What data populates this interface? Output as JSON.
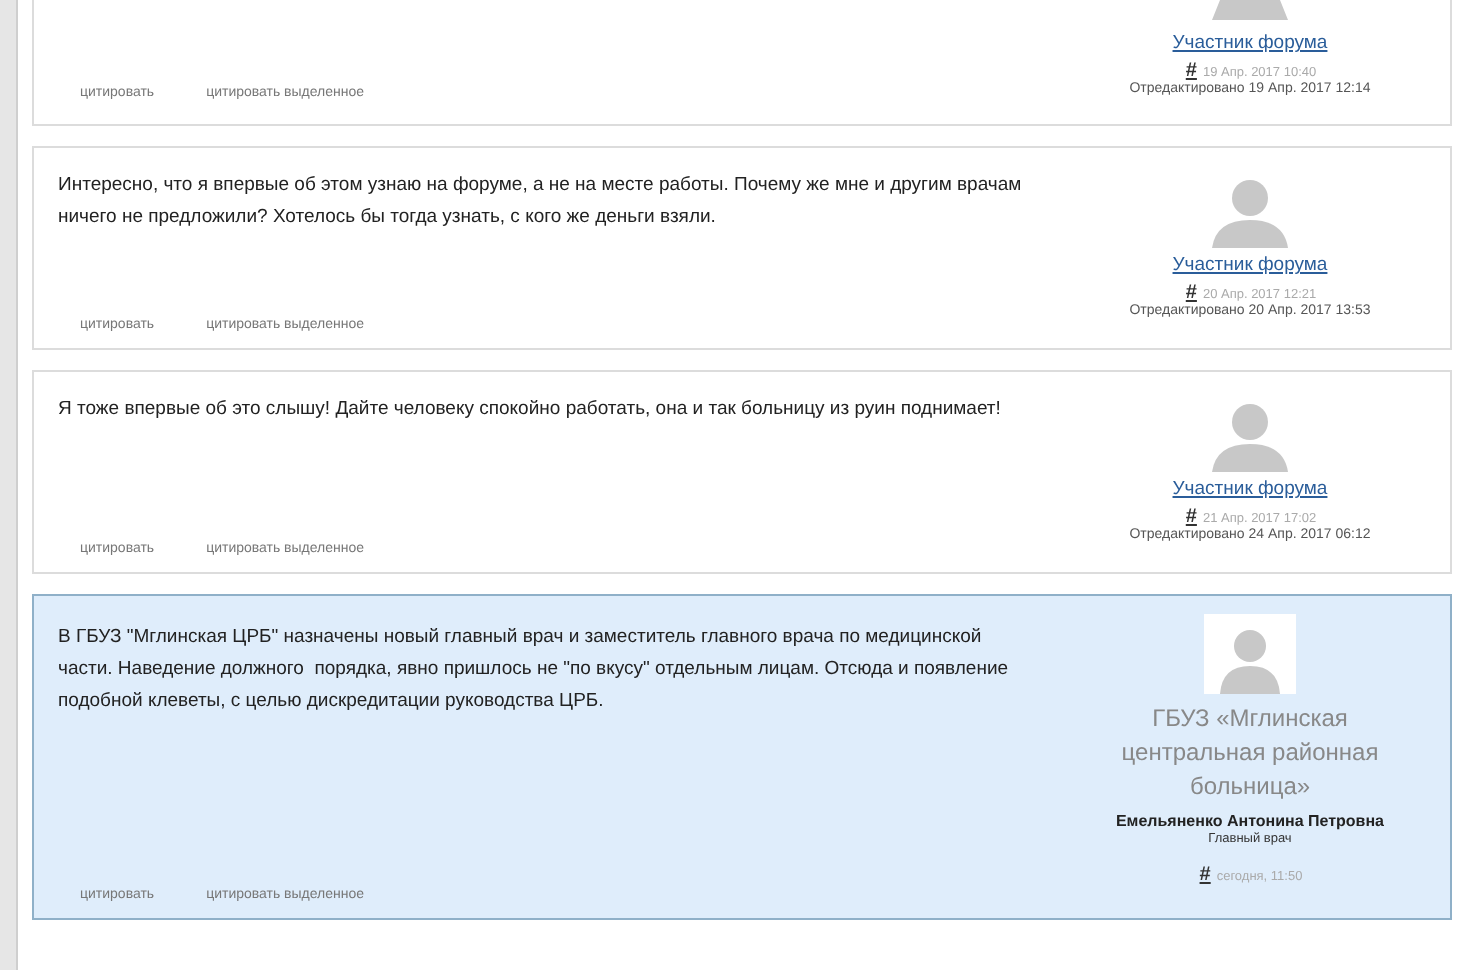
{
  "posts": [
    {
      "kind": "partial",
      "author": "Участник форума",
      "permalink": "#",
      "date": "19 Апр. 2017 10:40",
      "edited": "Отредактировано 19 Апр. 2017 12:14",
      "actions": [
        "цитировать",
        "цитировать выделенное"
      ]
    },
    {
      "kind": "member",
      "text": "Интересно, что я впервые об этом узнаю на форуме, а не на месте работы. Почему же мне и другим врачам ничего не предложили? Хотелось бы тогда узнать, с кого же деньги взяли.",
      "author": "Участник форума",
      "permalink": "#",
      "date": "20 Апр. 2017 12:21",
      "edited": "Отредактировано 20 Апр. 2017 13:53",
      "actions": [
        "цитировать",
        "цитировать выделенное"
      ]
    },
    {
      "kind": "member",
      "text": "Я тоже впервые об это слышу! Дайте человеку спокойно работать, она и так больницу из руин поднимает!",
      "author": "Участник форума",
      "permalink": "#",
      "date": "21 Апр. 2017 17:02",
      "edited": "Отредактировано 24 Апр. 2017 06:12",
      "actions": [
        "цитировать",
        "цитировать выделенное"
      ]
    },
    {
      "kind": "official",
      "text": "В ГБУЗ \"Мглинская ЦРБ\" назначены новый главный врач и заместитель главного врача по медицинской части. Наведение должного  порядка, явно пришлось не \"по вкусу\" отдельным лицам. Отсюда и появление подобной клеветы, с целью дискредитации руководства ЦРБ.",
      "author": "ГБУЗ «Мглинская центральная районная больница»",
      "person": "Емельяненко Антонина Петровна",
      "role": "Главный врач",
      "permalink": "#",
      "date": "сегодня, 11:50",
      "actions": [
        "цитировать",
        "цитировать выделенное"
      ]
    }
  ]
}
